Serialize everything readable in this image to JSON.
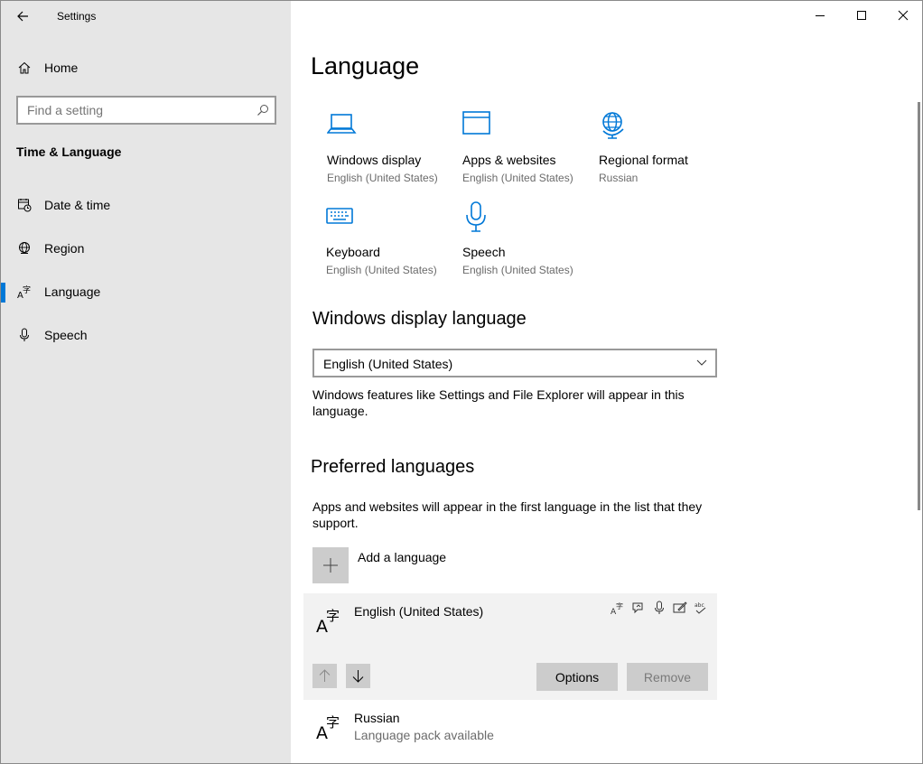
{
  "window": {
    "app_title": "Settings"
  },
  "sidebar": {
    "home_label": "Home",
    "search_placeholder": "Find a setting",
    "section_title": "Time & Language",
    "items": [
      {
        "label": "Date & time",
        "icon": "calendar-clock-icon"
      },
      {
        "label": "Region",
        "icon": "globe-icon"
      },
      {
        "label": "Language",
        "icon": "language-icon",
        "selected": true
      },
      {
        "label": "Speech",
        "icon": "microphone-icon"
      }
    ]
  },
  "main": {
    "title": "Language",
    "tiles": [
      {
        "name": "Windows display",
        "value": "English (United States)",
        "icon": "laptop-icon"
      },
      {
        "name": "Apps & websites",
        "value": "English (United States)",
        "icon": "window-icon"
      },
      {
        "name": "Regional format",
        "value": "Russian",
        "icon": "globe-icon"
      },
      {
        "name": "Keyboard",
        "value": "English (United States)",
        "icon": "keyboard-icon"
      },
      {
        "name": "Speech",
        "value": "English (United States)",
        "icon": "microphone-icon"
      }
    ],
    "display_language": {
      "heading": "Windows display language",
      "selected": "English (United States)",
      "description": "Windows features like Settings and File Explorer will appear in this language."
    },
    "preferred": {
      "heading": "Preferred languages",
      "description": "Apps and websites will appear in the first language in the list that they support.",
      "add_label": "Add a language",
      "languages": [
        {
          "name": "English (United States)",
          "subtitle": ""
        },
        {
          "name": "Russian",
          "subtitle": "Language pack available"
        }
      ],
      "options_label": "Options",
      "remove_label": "Remove",
      "feature_icons": [
        "display-language-icon",
        "text-to-speech-icon",
        "speech-recognition-icon",
        "handwriting-icon",
        "spellcheck-icon"
      ]
    }
  },
  "colors": {
    "accent": "#0078d7",
    "sidebar_bg": "#e6e6e6",
    "selected_card_bg": "#f2f2f2",
    "button_bg": "#cccccc"
  }
}
